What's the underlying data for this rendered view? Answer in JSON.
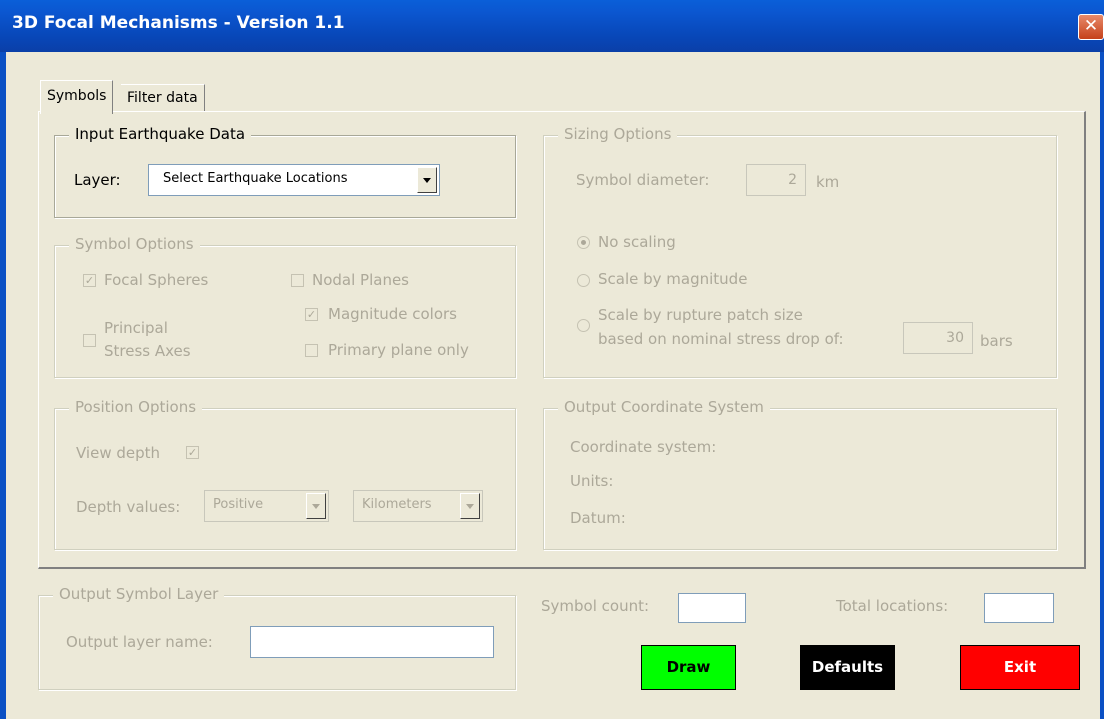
{
  "window": {
    "title": "3D Focal Mechanisms - Version 1.1",
    "close_glyph": "✕"
  },
  "tabs": [
    {
      "label": "Symbols",
      "active": true
    },
    {
      "label": "Filter data",
      "active": false
    }
  ],
  "input_group": {
    "title": "Input Earthquake Data",
    "layer_label": "Layer:",
    "layer_value": "Select Earthquake Locations"
  },
  "symbol_options": {
    "title": "Symbol Options",
    "focal_spheres": {
      "label": "Focal Spheres",
      "checked": true
    },
    "nodal_planes": {
      "label": "Nodal Planes",
      "checked": false
    },
    "magnitude_colors": {
      "label": "Magnitude colors",
      "checked": true
    },
    "principal_line1": "Principal",
    "principal_line2": "Stress Axes",
    "primary_plane": {
      "label": "Primary plane only",
      "checked": false
    }
  },
  "position_options": {
    "title": "Position Options",
    "view_depth_label": "View depth",
    "depth_values_label": "Depth values:",
    "depth_sign": "Positive",
    "depth_units": "Kilometers"
  },
  "sizing_options": {
    "title": "Sizing Options",
    "diameter_label": "Symbol diameter:",
    "diameter_value": "2",
    "diameter_unit": "km",
    "no_scaling": "No scaling",
    "scale_magnitude": "Scale by magnitude",
    "scale_rupture_line1": "Scale by rupture patch size",
    "scale_rupture_line2": "based on nominal stress drop of:",
    "stress_drop_value": "30",
    "stress_unit": "bars",
    "selected": "No scaling"
  },
  "output_coordinate": {
    "title": "Output Coordinate System",
    "coord_label": "Coordinate system:",
    "units_label": "Units:",
    "datum_label": "Datum:"
  },
  "output_symbol_layer": {
    "title": "Output Symbol Layer",
    "name_label": "Output layer name:",
    "name_value": ""
  },
  "counts": {
    "symbol_count_label": "Symbol count:",
    "symbol_count_value": "",
    "total_locations_label": "Total locations:",
    "total_locations_value": ""
  },
  "buttons": {
    "draw": {
      "label": "Draw",
      "color": "#00ff00"
    },
    "defaults": {
      "label": "Defaults",
      "color": "#000000"
    },
    "exit": {
      "label": "Exit",
      "color": "#ff0000"
    }
  }
}
